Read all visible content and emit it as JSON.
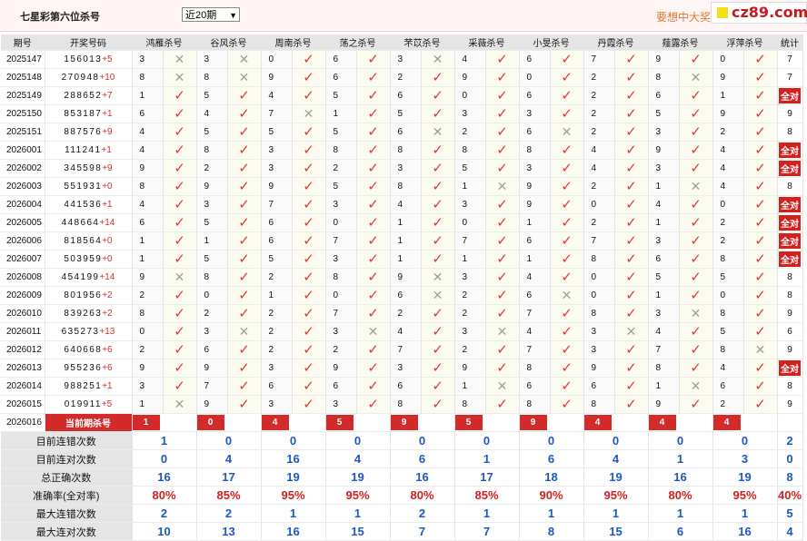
{
  "header": {
    "title": "七星彩第六位杀号",
    "select_value": "近20期",
    "promo": "要想中大奖",
    "logo": "cz89.com"
  },
  "columns": [
    "期号",
    "开奖号码",
    "鸿雁杀号",
    "谷风杀号",
    "周南杀号",
    "荡之杀号",
    "芣苡杀号",
    "采薇杀号",
    "小旻杀号",
    "丹霞杀号",
    "薤露杀号",
    "浮萍杀号",
    "统计"
  ],
  "rows": [
    {
      "period": "2025147",
      "digits": "156013",
      "plus": "+5",
      "kills": [
        [
          3,
          0
        ],
        [
          3,
          0
        ],
        [
          0,
          1
        ],
        [
          6,
          1
        ],
        [
          3,
          0
        ],
        [
          4,
          1
        ],
        [
          6,
          1
        ],
        [
          7,
          1
        ],
        [
          9,
          1
        ],
        [
          0,
          1
        ]
      ],
      "stat": "7"
    },
    {
      "period": "2025148",
      "digits": "270948",
      "plus": "+10",
      "kills": [
        [
          8,
          0
        ],
        [
          8,
          0
        ],
        [
          9,
          1
        ],
        [
          6,
          1
        ],
        [
          2,
          1
        ],
        [
          9,
          1
        ],
        [
          0,
          1
        ],
        [
          2,
          1
        ],
        [
          8,
          0
        ],
        [
          9,
          1
        ]
      ],
      "stat": "7"
    },
    {
      "period": "2025149",
      "digits": "288652",
      "plus": "+7",
      "kills": [
        [
          1,
          1
        ],
        [
          5,
          1
        ],
        [
          4,
          1
        ],
        [
          5,
          1
        ],
        [
          6,
          1
        ],
        [
          0,
          1
        ],
        [
          6,
          1
        ],
        [
          2,
          1
        ],
        [
          6,
          1
        ],
        [
          1,
          1
        ]
      ],
      "stat": "全对"
    },
    {
      "period": "2025150",
      "digits": "853187",
      "plus": "+1",
      "kills": [
        [
          6,
          1
        ],
        [
          4,
          1
        ],
        [
          7,
          0
        ],
        [
          1,
          1
        ],
        [
          5,
          1
        ],
        [
          3,
          1
        ],
        [
          3,
          1
        ],
        [
          2,
          1
        ],
        [
          5,
          1
        ],
        [
          9,
          1
        ]
      ],
      "stat": "9"
    },
    {
      "period": "2025151",
      "digits": "887576",
      "plus": "+9",
      "kills": [
        [
          4,
          1
        ],
        [
          5,
          1
        ],
        [
          5,
          1
        ],
        [
          5,
          1
        ],
        [
          6,
          0
        ],
        [
          2,
          1
        ],
        [
          6,
          0
        ],
        [
          2,
          1
        ],
        [
          3,
          1
        ],
        [
          2,
          1
        ]
      ],
      "stat": "8"
    },
    {
      "period": "2026001",
      "digits": "111241",
      "plus": "+1",
      "kills": [
        [
          4,
          1
        ],
        [
          8,
          1
        ],
        [
          3,
          1
        ],
        [
          8,
          1
        ],
        [
          8,
          1
        ],
        [
          8,
          1
        ],
        [
          8,
          1
        ],
        [
          4,
          1
        ],
        [
          9,
          1
        ],
        [
          4,
          1
        ]
      ],
      "stat": "全对"
    },
    {
      "period": "2026002",
      "digits": "345598",
      "plus": "+9",
      "kills": [
        [
          9,
          1
        ],
        [
          2,
          1
        ],
        [
          3,
          1
        ],
        [
          2,
          1
        ],
        [
          3,
          1
        ],
        [
          5,
          1
        ],
        [
          3,
          1
        ],
        [
          4,
          1
        ],
        [
          3,
          1
        ],
        [
          4,
          1
        ]
      ],
      "stat": "全对"
    },
    {
      "period": "2026003",
      "digits": "551931",
      "plus": "+0",
      "kills": [
        [
          8,
          1
        ],
        [
          9,
          1
        ],
        [
          9,
          1
        ],
        [
          5,
          1
        ],
        [
          8,
          1
        ],
        [
          1,
          0
        ],
        [
          9,
          1
        ],
        [
          2,
          1
        ],
        [
          1,
          0
        ],
        [
          4,
          1
        ]
      ],
      "stat": "8"
    },
    {
      "period": "2026004",
      "digits": "441536",
      "plus": "+1",
      "kills": [
        [
          4,
          1
        ],
        [
          3,
          1
        ],
        [
          7,
          1
        ],
        [
          3,
          1
        ],
        [
          4,
          1
        ],
        [
          3,
          1
        ],
        [
          9,
          1
        ],
        [
          0,
          1
        ],
        [
          4,
          1
        ],
        [
          0,
          1
        ]
      ],
      "stat": "全对"
    },
    {
      "period": "2026005",
      "digits": "448664",
      "plus": "+14",
      "kills": [
        [
          6,
          1
        ],
        [
          5,
          1
        ],
        [
          6,
          1
        ],
        [
          0,
          1
        ],
        [
          1,
          1
        ],
        [
          0,
          1
        ],
        [
          1,
          1
        ],
        [
          2,
          1
        ],
        [
          1,
          1
        ],
        [
          2,
          1
        ]
      ],
      "stat": "全对"
    },
    {
      "period": "2026006",
      "digits": "818564",
      "plus": "+0",
      "kills": [
        [
          1,
          1
        ],
        [
          1,
          1
        ],
        [
          6,
          1
        ],
        [
          7,
          1
        ],
        [
          1,
          1
        ],
        [
          7,
          1
        ],
        [
          6,
          1
        ],
        [
          7,
          1
        ],
        [
          3,
          1
        ],
        [
          2,
          1
        ]
      ],
      "stat": "全对"
    },
    {
      "period": "2026007",
      "digits": "503959",
      "plus": "+0",
      "kills": [
        [
          1,
          1
        ],
        [
          5,
          1
        ],
        [
          5,
          1
        ],
        [
          3,
          1
        ],
        [
          1,
          1
        ],
        [
          1,
          1
        ],
        [
          1,
          1
        ],
        [
          8,
          1
        ],
        [
          6,
          1
        ],
        [
          8,
          1
        ]
      ],
      "stat": "全对"
    },
    {
      "period": "2026008",
      "digits": "454199",
      "plus": "+14",
      "kills": [
        [
          9,
          0
        ],
        [
          8,
          1
        ],
        [
          2,
          1
        ],
        [
          8,
          1
        ],
        [
          9,
          0
        ],
        [
          3,
          1
        ],
        [
          4,
          1
        ],
        [
          0,
          1
        ],
        [
          5,
          1
        ],
        [
          5,
          1
        ]
      ],
      "stat": "8"
    },
    {
      "period": "2026009",
      "digits": "801956",
      "plus": "+2",
      "kills": [
        [
          2,
          1
        ],
        [
          0,
          1
        ],
        [
          1,
          1
        ],
        [
          0,
          1
        ],
        [
          6,
          0
        ],
        [
          2,
          1
        ],
        [
          6,
          0
        ],
        [
          0,
          1
        ],
        [
          1,
          1
        ],
        [
          0,
          1
        ]
      ],
      "stat": "8"
    },
    {
      "period": "2026010",
      "digits": "839263",
      "plus": "+2",
      "kills": [
        [
          8,
          1
        ],
        [
          2,
          1
        ],
        [
          2,
          1
        ],
        [
          7,
          1
        ],
        [
          2,
          1
        ],
        [
          2,
          1
        ],
        [
          7,
          1
        ],
        [
          8,
          1
        ],
        [
          3,
          0
        ],
        [
          8,
          1
        ]
      ],
      "stat": "9"
    },
    {
      "period": "2026011",
      "digits": "635273",
      "plus": "+13",
      "kills": [
        [
          0,
          1
        ],
        [
          3,
          0
        ],
        [
          2,
          1
        ],
        [
          3,
          0
        ],
        [
          4,
          1
        ],
        [
          3,
          0
        ],
        [
          4,
          1
        ],
        [
          3,
          0
        ],
        [
          4,
          1
        ],
        [
          5,
          1
        ]
      ],
      "stat": "6"
    },
    {
      "period": "2026012",
      "digits": "640668",
      "plus": "+6",
      "kills": [
        [
          2,
          1
        ],
        [
          6,
          1
        ],
        [
          2,
          1
        ],
        [
          2,
          1
        ],
        [
          7,
          1
        ],
        [
          2,
          1
        ],
        [
          7,
          1
        ],
        [
          3,
          1
        ],
        [
          7,
          1
        ],
        [
          8,
          0
        ]
      ],
      "stat": "9"
    },
    {
      "period": "2026013",
      "digits": "955236",
      "plus": "+6",
      "kills": [
        [
          9,
          1
        ],
        [
          9,
          1
        ],
        [
          3,
          1
        ],
        [
          9,
          1
        ],
        [
          3,
          1
        ],
        [
          9,
          1
        ],
        [
          8,
          1
        ],
        [
          9,
          1
        ],
        [
          8,
          1
        ],
        [
          4,
          1
        ]
      ],
      "stat": "全对"
    },
    {
      "period": "2026014",
      "digits": "988251",
      "plus": "+1",
      "kills": [
        [
          3,
          1
        ],
        [
          7,
          1
        ],
        [
          6,
          1
        ],
        [
          6,
          1
        ],
        [
          6,
          1
        ],
        [
          1,
          0
        ],
        [
          6,
          1
        ],
        [
          6,
          1
        ],
        [
          1,
          0
        ],
        [
          6,
          1
        ]
      ],
      "stat": "8"
    },
    {
      "period": "2026015",
      "digits": "019911",
      "plus": "+5",
      "kills": [
        [
          1,
          0
        ],
        [
          9,
          1
        ],
        [
          3,
          1
        ],
        [
          3,
          1
        ],
        [
          8,
          1
        ],
        [
          8,
          1
        ],
        [
          8,
          1
        ],
        [
          8,
          1
        ],
        [
          9,
          1
        ],
        [
          2,
          1
        ]
      ],
      "stat": "9"
    }
  ],
  "current": {
    "period": "2026016",
    "label": "当前期杀号",
    "kills": [
      "1",
      "0",
      "4",
      "5",
      "9",
      "5",
      "9",
      "4",
      "4",
      "4"
    ]
  },
  "summary": [
    {
      "label": "目前连错次数",
      "values": [
        "1",
        "0",
        "0",
        "0",
        "0",
        "0",
        "0",
        "0",
        "0",
        "0",
        "2"
      ]
    },
    {
      "label": "目前连对次数",
      "values": [
        "0",
        "4",
        "16",
        "4",
        "6",
        "1",
        "6",
        "4",
        "1",
        "3",
        "0"
      ]
    },
    {
      "label": "总正确次数",
      "values": [
        "16",
        "17",
        "19",
        "19",
        "16",
        "17",
        "18",
        "19",
        "16",
        "19",
        "8"
      ]
    },
    {
      "label": "准确率(全对率)",
      "values": [
        "80%",
        "85%",
        "95%",
        "95%",
        "80%",
        "85%",
        "90%",
        "95%",
        "80%",
        "95%",
        "40%"
      ],
      "rate": true
    },
    {
      "label": "最大连错次数",
      "values": [
        "2",
        "2",
        "1",
        "1",
        "2",
        "1",
        "1",
        "1",
        "1",
        "1",
        "5"
      ]
    },
    {
      "label": "最大连对次数",
      "values": [
        "10",
        "13",
        "16",
        "15",
        "7",
        "7",
        "8",
        "15",
        "6",
        "16",
        "4"
      ]
    }
  ],
  "icons": {
    "ok": "check-icon",
    "bad": "cross-icon"
  },
  "colors": {
    "accent": "#d32a2a",
    "value_blue": "#1f57c3"
  }
}
